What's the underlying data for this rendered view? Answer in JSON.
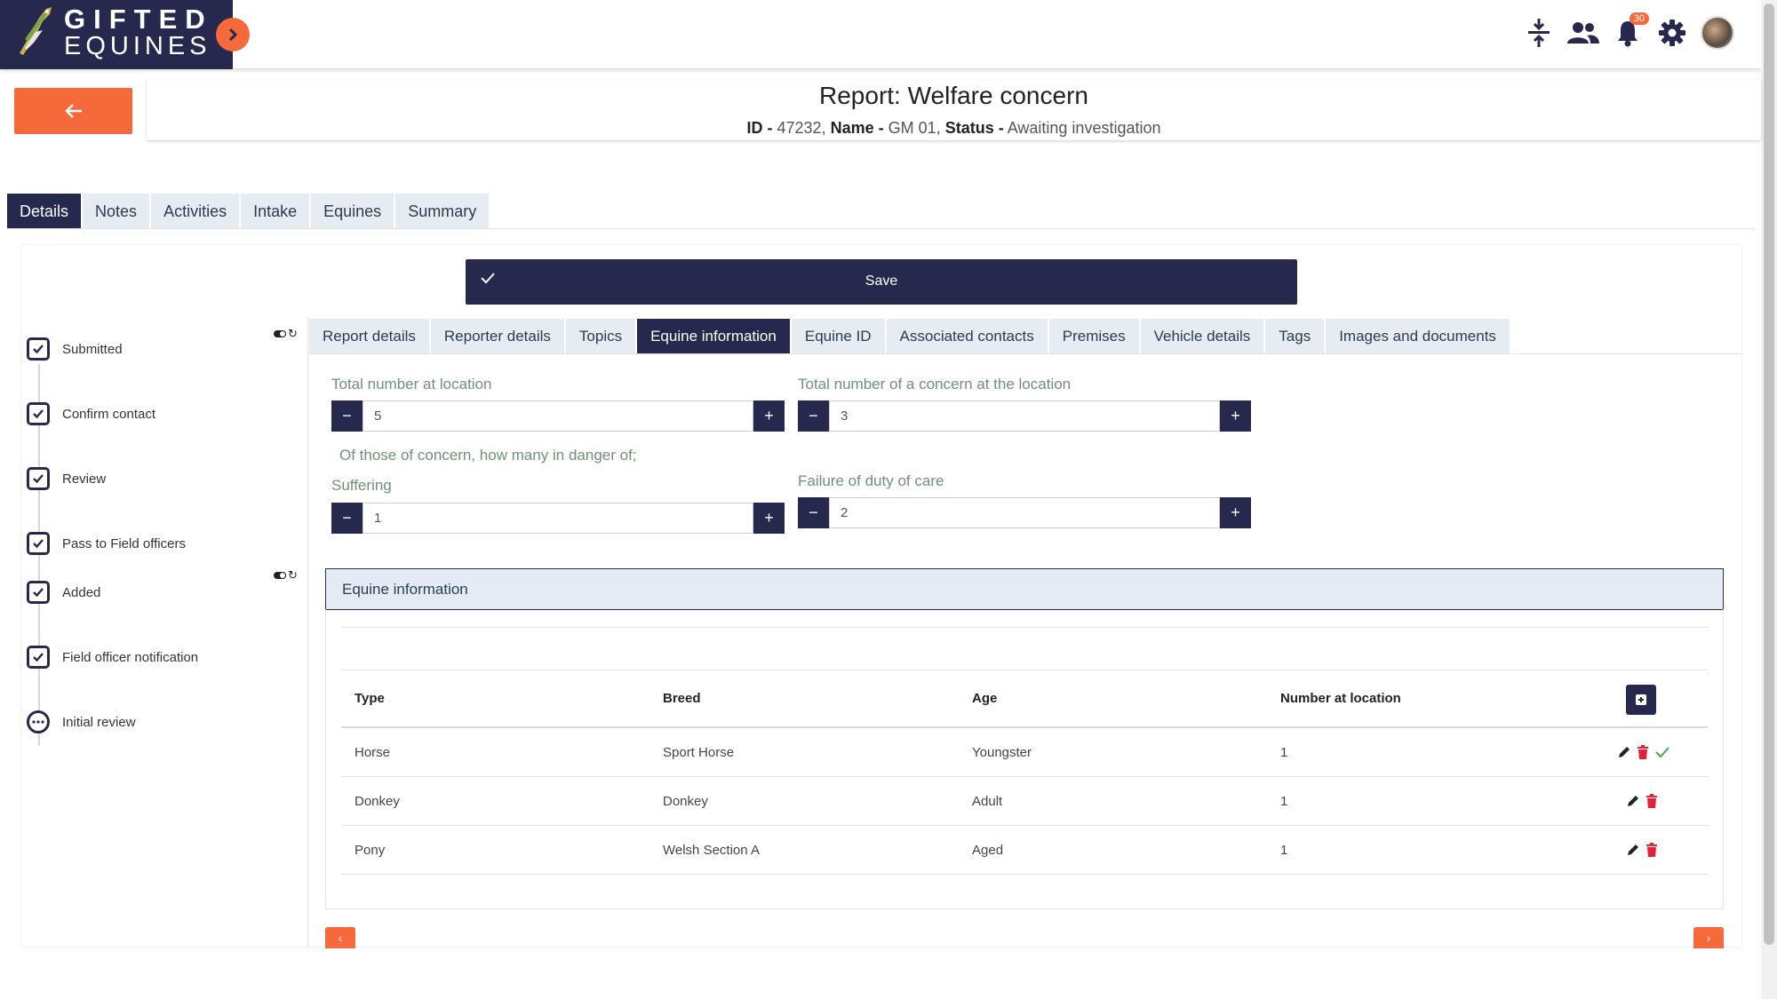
{
  "brand": {
    "line1": "GIFTED",
    "line2": "EQUINES",
    "color": "#26284e",
    "accent": "#f5693a"
  },
  "header": {
    "icons": [
      "collapse-vertical-icon",
      "users-icon",
      "bell-icon",
      "gear-icon",
      "avatar"
    ],
    "notification_count": "30"
  },
  "report": {
    "title": "Report: Welfare concern",
    "id_label": "ID -",
    "id_value": "47232,",
    "name_label": "Name -",
    "name_value": "GM 01,",
    "status_label": "Status -",
    "status_value": "Awaiting investigation"
  },
  "main_tabs": [
    {
      "label": "Details",
      "active": true
    },
    {
      "label": "Notes"
    },
    {
      "label": "Activities"
    },
    {
      "label": "Intake"
    },
    {
      "label": "Equines"
    },
    {
      "label": "Summary"
    }
  ],
  "save_label": "Save",
  "steps": [
    {
      "label": "Submitted",
      "state": "done"
    },
    {
      "label": "Confirm contact",
      "state": "done"
    },
    {
      "label": "Review",
      "state": "done"
    },
    {
      "label": "Pass to Field officers",
      "state": "done"
    },
    {
      "label": "Added",
      "state": "done"
    },
    {
      "label": "Field officer notification",
      "state": "done"
    },
    {
      "label": "Initial review",
      "state": "pending"
    }
  ],
  "sub_tabs": [
    {
      "label": "Report details"
    },
    {
      "label": "Reporter details"
    },
    {
      "label": "Topics"
    },
    {
      "label": "Equine information",
      "active": true
    },
    {
      "label": "Equine ID"
    },
    {
      "label": "Associated contacts"
    },
    {
      "label": "Premises"
    },
    {
      "label": "Vehicle details"
    },
    {
      "label": "Tags"
    },
    {
      "label": "Images and documents"
    }
  ],
  "fields": {
    "total_at_location": {
      "label": "Total number at location",
      "value": "5"
    },
    "total_concern": {
      "label": "Total number of a concern at the location",
      "value": "3"
    },
    "danger_heading": "Of those of concern, how many in danger of;",
    "suffering": {
      "label": "Suffering",
      "value": "1"
    },
    "failure_duty": {
      "label": "Failure of duty of care",
      "value": "2"
    }
  },
  "equine_info": {
    "title": "Equine information",
    "columns": [
      "Type",
      "Breed",
      "Age",
      "Number at location"
    ],
    "rows": [
      {
        "type": "Horse",
        "breed": "Sport Horse",
        "age": "Youngster",
        "number": "1"
      },
      {
        "type": "Donkey",
        "breed": "Donkey",
        "age": "Adult",
        "number": "1"
      },
      {
        "type": "Pony",
        "breed": "Welsh Section A",
        "age": "Aged",
        "number": "1"
      }
    ]
  },
  "pagination": {
    "prev": "‹",
    "next": "›"
  }
}
